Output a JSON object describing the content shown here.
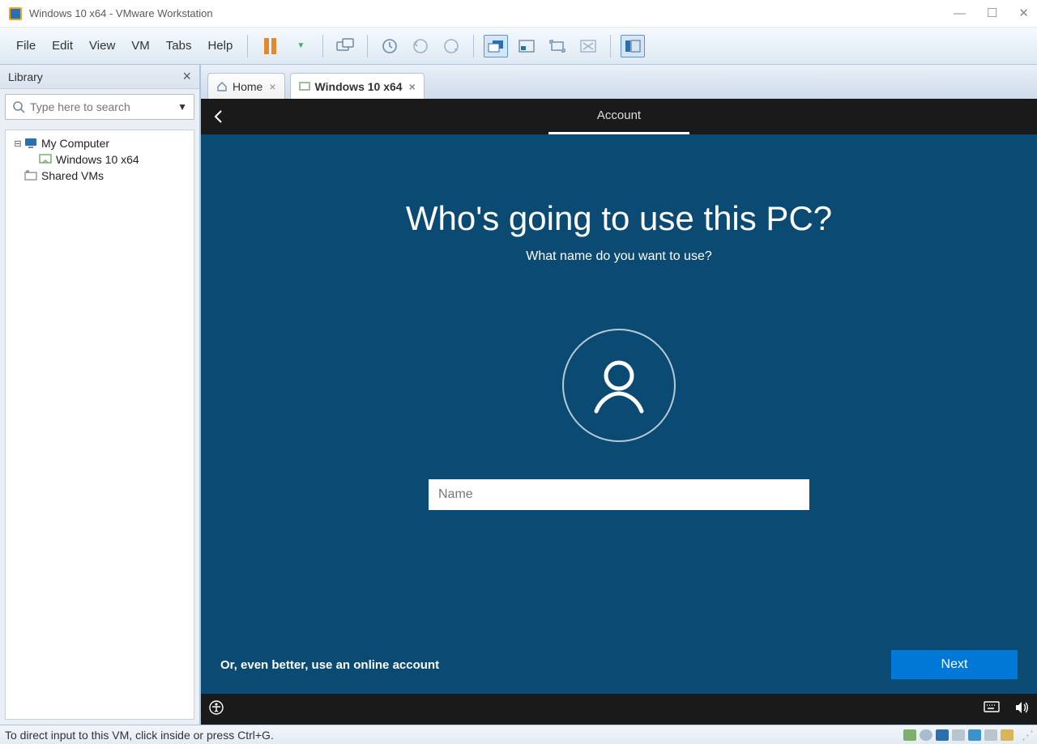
{
  "window": {
    "title": "Windows 10 x64 - VMware Workstation"
  },
  "menu": {
    "file": "File",
    "edit": "Edit",
    "view": "View",
    "vm": "VM",
    "tabs": "Tabs",
    "help": "Help"
  },
  "sidebar": {
    "title": "Library",
    "search_placeholder": "Type here to search",
    "tree": {
      "root": "My Computer",
      "vm": "Windows 10 x64",
      "shared": "Shared VMs"
    }
  },
  "tabs": {
    "home": "Home",
    "active": "Windows 10 x64"
  },
  "guest": {
    "section": "Account",
    "heading": "Who's going to use this PC?",
    "subheading": "What name do you want to use?",
    "name_placeholder": "Name",
    "online_link": "Or, even better, use an online account",
    "next": "Next"
  },
  "status": {
    "hint": "To direct input to this VM, click inside or press Ctrl+G."
  }
}
